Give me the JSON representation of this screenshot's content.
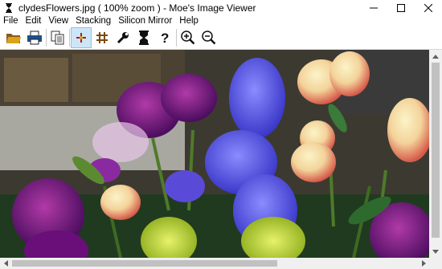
{
  "window": {
    "title": "clydesFlowers.jpg ( 100% zoom ) - Moe's Image Viewer"
  },
  "menu": [
    "File",
    "Edit",
    "View",
    "Stacking",
    "Silicon Mirror",
    "Help"
  ],
  "toolbar": {
    "buttons": [
      "open-folder-icon",
      "print-icon",
      "copy-icon",
      "crosshair-icon",
      "grid-icon",
      "wrench-icon",
      "stack-icon",
      "help-icon",
      "zoom-in-icon",
      "zoom-out-icon"
    ],
    "active": "crosshair-icon"
  },
  "image": {
    "filename": "clydesFlowers.jpg",
    "zoom": "100%"
  },
  "colors": {
    "toolbar_active": "#cde6f7",
    "scrollbar": "#f0f0f0"
  }
}
